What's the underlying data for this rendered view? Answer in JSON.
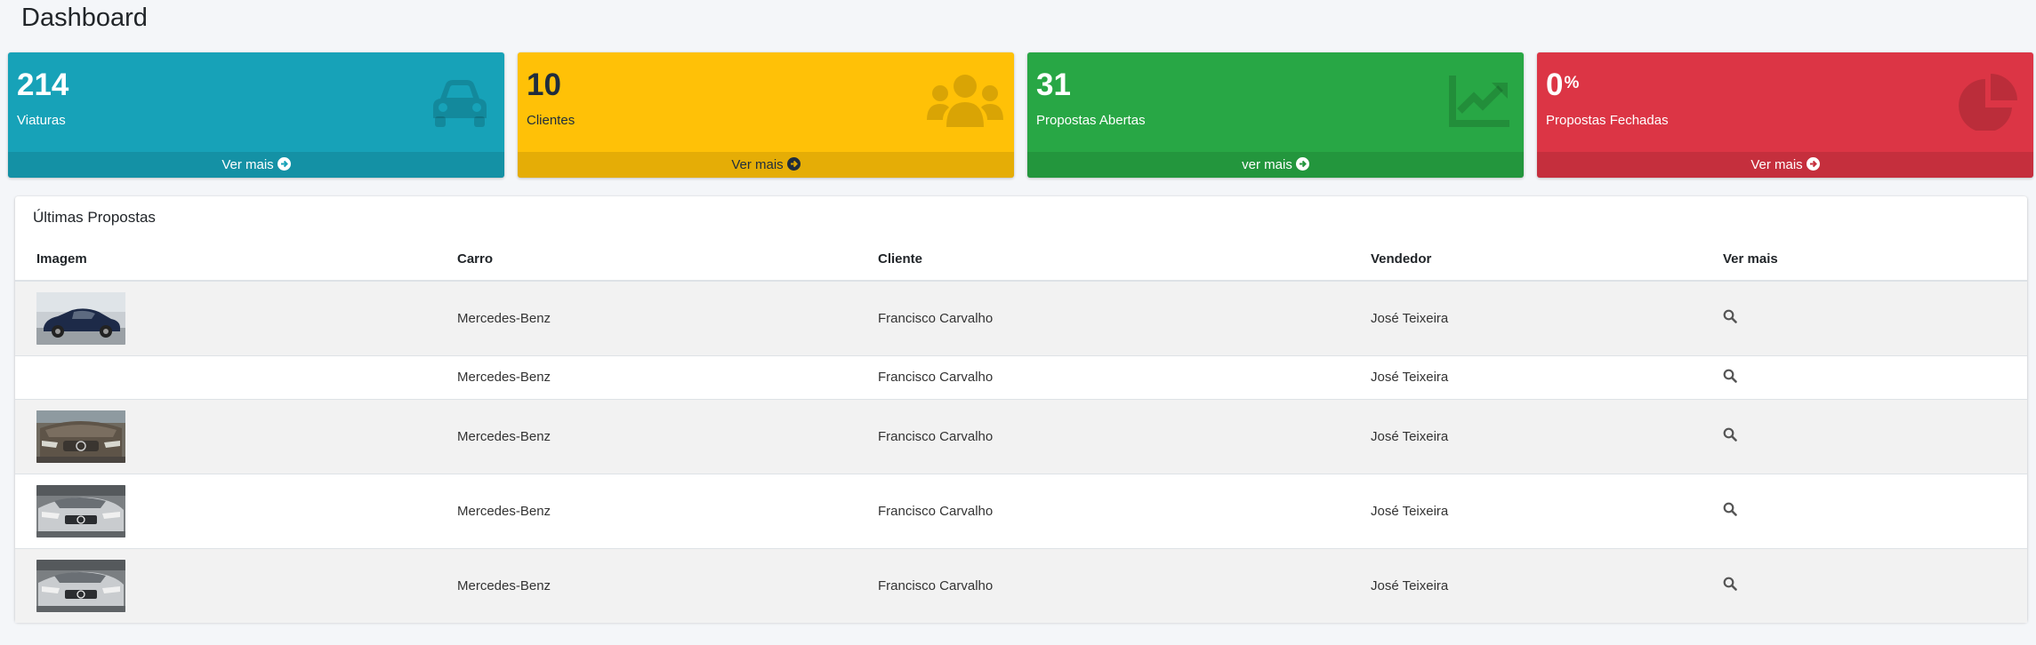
{
  "page": {
    "title": "Dashboard"
  },
  "stats": [
    {
      "value": "214",
      "suffix": "",
      "label": "Viaturas",
      "link": "Ver mais",
      "icon": "car-icon",
      "color": "#17a2b8"
    },
    {
      "value": "10",
      "suffix": "",
      "label": "Clientes",
      "link": "Ver mais",
      "icon": "users-icon",
      "color": "#ffc107"
    },
    {
      "value": "31",
      "suffix": "",
      "label": "Propostas Abertas",
      "link": "ver mais",
      "icon": "chart-line-icon",
      "color": "#28a745"
    },
    {
      "value": "0",
      "suffix": "%",
      "label": "Propostas Fechadas",
      "link": "Ver mais",
      "icon": "chart-pie-icon",
      "color": "#dc3545"
    }
  ],
  "proposals": {
    "title": "Últimas Propostas",
    "columns": [
      "Imagem",
      "Carro",
      "Cliente",
      "Vendedor",
      "Ver mais"
    ],
    "rows": [
      {
        "image": "dark-blue-suv",
        "car": "Mercedes-Benz",
        "client": "Francisco Carvalho",
        "seller": "José Teixeira"
      },
      {
        "image": "",
        "car": "Mercedes-Benz",
        "client": "Francisco Carvalho",
        "seller": "José Teixeira"
      },
      {
        "image": "dusty-front",
        "car": "Mercedes-Benz",
        "client": "Francisco Carvalho",
        "seller": "José Teixeira"
      },
      {
        "image": "silver-front",
        "car": "Mercedes-Benz",
        "client": "Francisco Carvalho",
        "seller": "José Teixeira"
      },
      {
        "image": "silver-front",
        "car": "Mercedes-Benz",
        "client": "Francisco Carvalho",
        "seller": "José Teixeira"
      }
    ]
  }
}
